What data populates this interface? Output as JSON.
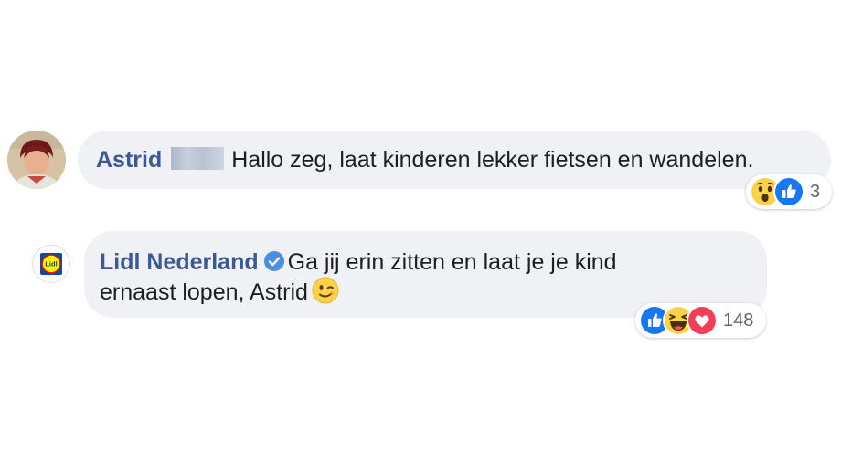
{
  "comments": [
    {
      "author": "Astrid",
      "text": "Hallo zeg, laat kinderen lekker fietsen en wandelen.",
      "reactions": [
        "wow",
        "like"
      ],
      "reaction_count": "3"
    },
    {
      "author": "Lidl Nederland",
      "verified": true,
      "text_line1": "Ga jij erin zitten en laat je je kind",
      "text_line2": "ernaast lopen, Astrid",
      "reactions": [
        "like",
        "haha",
        "love"
      ],
      "reaction_count": "148"
    }
  ],
  "avatar_logo_text": "Lidl",
  "colors": {
    "bubble": "#f0f1f4",
    "author": "#3b5998",
    "like": "#1877f2",
    "love": "#f33e58",
    "emoji": "#fcd24a"
  }
}
